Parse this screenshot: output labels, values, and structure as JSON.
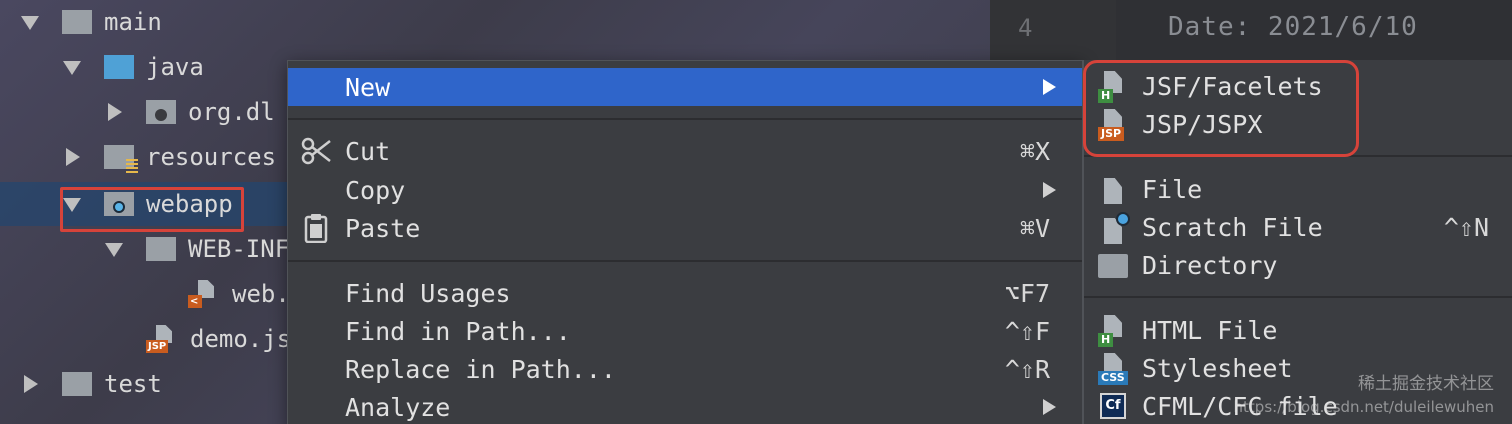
{
  "project_tree": {
    "rows": [
      {
        "label": "main",
        "expanded": true
      },
      {
        "label": "java",
        "expanded": true
      },
      {
        "label": "org.dl",
        "expanded": false
      },
      {
        "label": "resources",
        "expanded": false
      },
      {
        "label": "webapp",
        "expanded": true,
        "selected": true
      },
      {
        "label": "WEB-INF",
        "expanded": true
      },
      {
        "label": "web.",
        "file_type": "xml"
      },
      {
        "label": "demo.js",
        "file_type": "JSP"
      },
      {
        "label": "test",
        "expanded": false
      }
    ]
  },
  "editor": {
    "line_number": "4",
    "code_text": "Date: 2021/6/10"
  },
  "context_menu": {
    "items": [
      {
        "label": "New",
        "shortcut": "",
        "has_submenu": true,
        "active": true
      },
      {
        "label": "Cut",
        "shortcut": "⌘X",
        "icon": "scissors-icon"
      },
      {
        "label": "Copy",
        "shortcut": "",
        "has_submenu": true
      },
      {
        "label": "Paste",
        "shortcut": "⌘V",
        "icon": "clipboard-icon"
      },
      {
        "label": "Find Usages",
        "shortcut": "⌥F7"
      },
      {
        "label": "Find in Path...",
        "shortcut": "^⇧F"
      },
      {
        "label": "Replace in Path...",
        "shortcut": "^⇧R"
      },
      {
        "label": "Analyze",
        "shortcut": "",
        "has_submenu": true
      }
    ]
  },
  "new_submenu": {
    "items": [
      {
        "label": "JSF/Facelets",
        "icon": "jsf-file-icon",
        "tag": "H"
      },
      {
        "label": "JSP/JSPX",
        "icon": "jsp-file-icon",
        "tag": "JSP"
      },
      {
        "label": "File",
        "icon": "file-icon"
      },
      {
        "label": "Scratch File",
        "icon": "scratch-file-icon",
        "shortcut": "^⇧N"
      },
      {
        "label": "Directory",
        "icon": "folder-icon"
      },
      {
        "label": "HTML File",
        "icon": "html-file-icon",
        "tag": "H"
      },
      {
        "label": "Stylesheet",
        "icon": "stylesheet-icon",
        "tag": "CSS"
      },
      {
        "label": "CFML/CFC file",
        "icon": "cfml-icon",
        "tag": "Cf"
      }
    ]
  },
  "watermark": {
    "cn": "稀土掘金技术社区",
    "url": "https://blog.csdn.net/duleilewuhen"
  },
  "colors": {
    "menu_bg": "#3b3d41",
    "active_item": "#2f65ca",
    "highlight_box": "#d6433a",
    "folder_blue": "#4fa1d6",
    "jsp_orange": "#c95c1f"
  }
}
